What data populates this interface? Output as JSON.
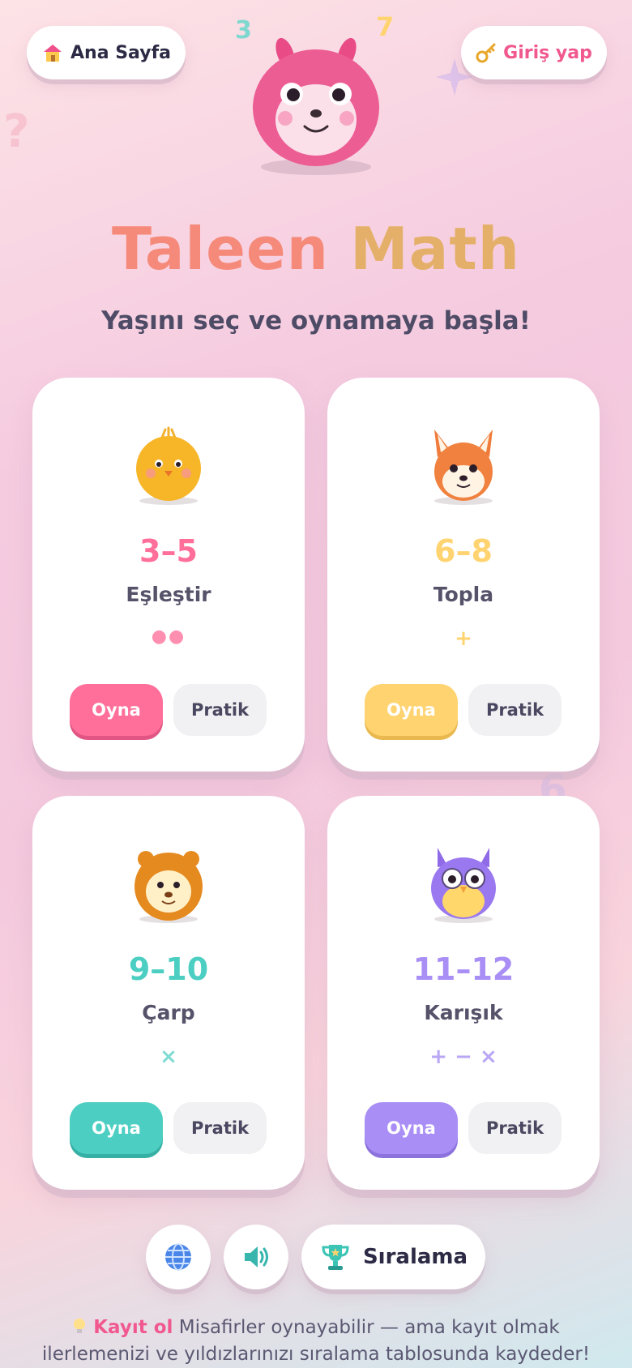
{
  "header": {
    "home_label": "Ana Sayfa",
    "home_icon": "house-icon",
    "login_label": "Giriş yap",
    "login_icon": "key-icon"
  },
  "hero": {
    "title_part1": "Taleen",
    "title_part2": "Math",
    "subtitle": "Yaşını seç ve oynamaya başla!"
  },
  "cards": [
    {
      "range": "3–5",
      "game": "Eşleştir",
      "symbol": "●●",
      "play": "Oyna",
      "practice": "Pratik",
      "color": "#ff6f9a",
      "avatar": "chick-icon"
    },
    {
      "range": "6–8",
      "game": "Topla",
      "symbol": "+",
      "play": "Oyna",
      "practice": "Pratik",
      "color": "#ffd470",
      "avatar": "fox-icon"
    },
    {
      "range": "9–10",
      "game": "Çarp",
      "symbol": "×",
      "play": "Oyna",
      "practice": "Pratik",
      "color": "#4ccfc2",
      "avatar": "lion-icon"
    },
    {
      "range": "11–12",
      "game": "Karışık",
      "symbol": "+ − ×",
      "play": "Oyna",
      "practice": "Pratik",
      "color": "#a98ff5",
      "avatar": "owl-icon"
    }
  ],
  "bottom": {
    "language_icon": "globe-icon",
    "sound_icon": "speaker-icon",
    "leaderboard_label": "Sıralama",
    "leaderboard_icon": "trophy-icon"
  },
  "footer": {
    "bulb_icon": "lightbulb-icon",
    "register_link": "Kayıt ol",
    "message": "Misafirler oynayabilir — ama kayıt olmak ilerlemenizi ve yıldızlarınızı sıralama tablosunda kaydeder!"
  }
}
